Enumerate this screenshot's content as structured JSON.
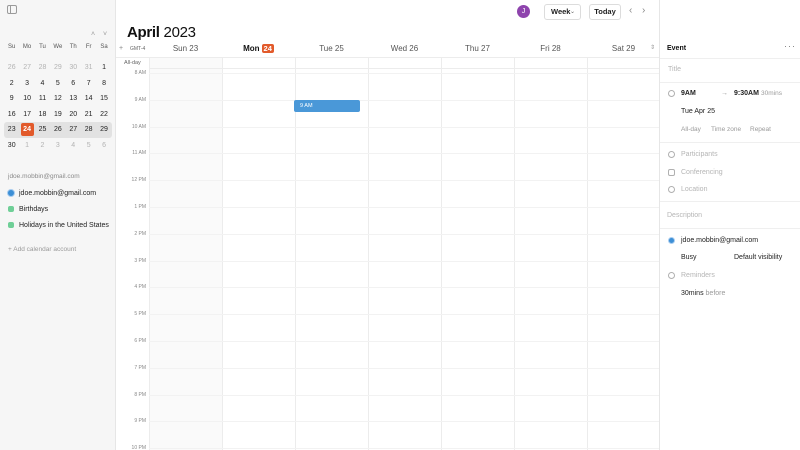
{
  "sidebar": {
    "mini_calendar": {
      "nav_up": "˄",
      "nav_down": "˅",
      "weekdays": [
        "Su",
        "Mo",
        "Tu",
        "We",
        "Th",
        "Fr",
        "Sa"
      ],
      "weeks": [
        [
          "26",
          "27",
          "28",
          "29",
          "30",
          "31",
          "1"
        ],
        [
          "2",
          "3",
          "4",
          "5",
          "6",
          "7",
          "8"
        ],
        [
          "9",
          "10",
          "11",
          "12",
          "13",
          "14",
          "15"
        ],
        [
          "16",
          "17",
          "18",
          "19",
          "20",
          "21",
          "22"
        ],
        [
          "23",
          "24",
          "25",
          "26",
          "27",
          "28",
          "29"
        ],
        [
          "30",
          "1",
          "2",
          "3",
          "4",
          "5",
          "6"
        ]
      ]
    },
    "account_email": "jdoe.mobbin@gmail.com",
    "calendars": [
      {
        "label": "jdoe.mobbin@gmail.com",
        "color": "#3d8fd6"
      },
      {
        "label": "Birthdays",
        "color": "#6fcf97"
      },
      {
        "label": "Holidays in the United States",
        "color": "#6fcf97"
      }
    ],
    "add_account": "+ Add calendar account"
  },
  "header": {
    "month": "April",
    "year": "2023",
    "avatar_initial": "J",
    "view_label": "Week",
    "today_label": "Today",
    "prev": "‹",
    "next": "›"
  },
  "week": {
    "timezone": "GMT-4",
    "add": "+",
    "scroll": "⇕",
    "all_day_label": "All-day",
    "days": [
      {
        "label": "Sun 23"
      },
      {
        "label": "Mon",
        "badge": "24",
        "today": true
      },
      {
        "label": "Tue 25"
      },
      {
        "label": "Wed 26"
      },
      {
        "label": "Thu 27"
      },
      {
        "label": "Fri 28"
      },
      {
        "label": "Sat 29"
      }
    ],
    "hours": [
      "8 AM",
      "9 AM",
      "10 AM",
      "11 AM",
      "12 PM",
      "1 PM",
      "2 PM",
      "3 PM",
      "4 PM",
      "5 PM",
      "6 PM",
      "7 PM",
      "8 PM",
      "9 PM",
      "10 PM"
    ],
    "event": {
      "label": "9 AM",
      "day": "Tue 25",
      "color": "#4a98d8"
    }
  },
  "panel": {
    "title": "Event",
    "more": "···",
    "title_placeholder": "Title",
    "start_time": "9AM",
    "arrow": "→",
    "end_time": "9:30AM",
    "duration": "30mins",
    "date": "Tue Apr 25",
    "options": [
      "All-day",
      "Time zone",
      "Repeat"
    ],
    "participants": "Participants",
    "conferencing": "Conferencing",
    "location": "Location",
    "description": "Description",
    "calendar": "jdoe.mobbin@gmail.com",
    "availability": "Busy",
    "visibility": "Default visibility",
    "reminders": "Reminders",
    "reminder_value": "30mins",
    "reminder_suffix": "before"
  },
  "colors": {
    "accent": "#e25a2b",
    "event_blue": "#4a98d8",
    "avatar": "#8e44ad"
  }
}
